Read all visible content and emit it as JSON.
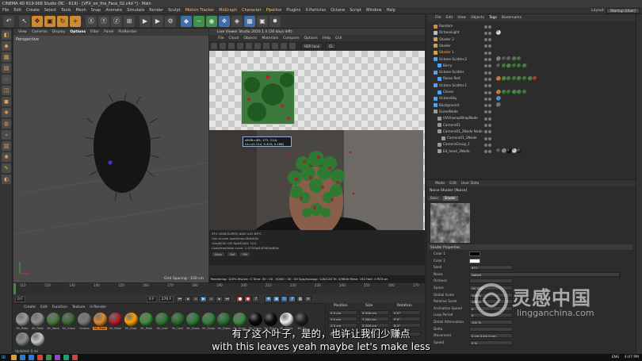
{
  "window": {
    "title": "CINEMA 4D R19.068 Studio (RC - R19) - [VFX_on_the_Face_02.c4d *] - Main",
    "layout_label": "Layout:",
    "layout_value": "Startup (User)"
  },
  "menubar": [
    "File",
    "Edit",
    "Create",
    "Select",
    "Tools",
    "Mesh",
    "Snap",
    "Animate",
    "Simulate",
    "Render",
    "Sculpt",
    "Motion Tracker",
    "MoGraph",
    "Character",
    "Pipeline",
    "Plugins",
    "X-Particles",
    "Octane",
    "Script",
    "Window",
    "Help"
  ],
  "viewport": {
    "menu": [
      "View",
      "Cameras",
      "Display",
      "Options",
      "Filter",
      "Panel",
      "ProRender"
    ],
    "label": "Perspective",
    "grid_spacing": "Grid Spacing : 100 cm"
  },
  "ipr": {
    "title": "Live Viewer Studio 2020.1.4 (26 days left)",
    "menu": [
      "File",
      "Cloud",
      "Objects",
      "Materials",
      "Compare",
      "Options",
      "Help",
      "GUI"
    ],
    "mode": "HDR tone",
    "channel": "DL",
    "pixel_info_1": "sRGB=(85, 173, 114)",
    "pixel_info_2": "Lin=(0.114, 0.419, 0.168)",
    "stats": [
      "RTX 2080(SUPER) 8GB     %25     89°C",
      "Out-of-core used/max:0Kb/4Gb",
      "GreyB/16: 0/0          Rgb32/64: 7/21",
      "Used/free/total vram: 1.473Gb/6.836Gb/8Gb"
    ],
    "stats_tabs": [
      "Main",
      "Ref",
      "Pth"
    ],
    "status": "Rendering: 100%  Ms/sec: 0  Time: 00 : 00 : 00/00 : 00 : 00  Spp/maxspp: 128/128  Tri: 0/964k  Mesh: 192  Hair: 0  RTX:on"
  },
  "timeline": {
    "ticks": [
      "110",
      "120",
      "130",
      "140",
      "150",
      "160",
      "170",
      "180",
      "190",
      "200",
      "210",
      "220",
      "230",
      "240",
      "250",
      "260",
      "270"
    ],
    "frame_start": "0 F",
    "frame_current": "0 F",
    "frame_end": "270 F",
    "frame_max": "270 F",
    "fps_label": "127 F"
  },
  "materials": {
    "menu": [
      "Create",
      "Edit",
      "Function",
      "Texture",
      "U-Render"
    ],
    "items": [
      {
        "name": "Mr_Petal",
        "color": "#9a9a9a",
        "selected": false
      },
      {
        "name": "Mr_Petal",
        "color": "#8f8f8f",
        "selected": false
      },
      {
        "name": "Mr_Stem",
        "color": "#4c7a3c",
        "selected": false
      },
      {
        "name": "Mr_Grass",
        "color": "#3f6a35",
        "selected": false
      },
      {
        "name": "Octane",
        "color": "#7a7a7a",
        "selected": false
      },
      {
        "name": "Mr_Petal",
        "color": "#e08830",
        "selected": true
      },
      {
        "name": "Mr_Petal",
        "color": "#b01e2a",
        "selected": false
      },
      {
        "name": "Mr_Drop",
        "color": "#ffa000",
        "selected": false
      },
      {
        "name": "Mr_Petal",
        "color": "#3e8f3e",
        "selected": false
      },
      {
        "name": "Mr_Leaf",
        "color": "#2e7a32",
        "selected": false
      },
      {
        "name": "Mr_Leaf",
        "color": "#2b6b2e",
        "selected": false
      },
      {
        "name": "Mr_Grass",
        "color": "#2f7d36",
        "selected": false
      },
      {
        "name": "Mr_Grass",
        "color": "#33843a",
        "selected": false
      },
      {
        "name": "Mr_Grass",
        "color": "#2a6f30",
        "selected": false
      },
      {
        "name": "Mr_Grass",
        "color": "#3b8a40",
        "selected": false
      },
      {
        "name": "Mr_Grass",
        "color": "#080808",
        "selected": false
      },
      {
        "name": "Mr_Grass",
        "color": "#0d0d0d",
        "selected": false
      },
      {
        "name": "Mr_Grass",
        "color": "#eeeeee",
        "selected": false
      },
      {
        "name": "Mr_Gr",
        "color": "#222222",
        "selected": false
      }
    ],
    "row2": [
      {
        "name": "",
        "color": "#8a8a8a"
      },
      {
        "name": "",
        "color": "#c4c4c4"
      }
    ]
  },
  "coords": {
    "headers": [
      "Position",
      "Size",
      "Rotation"
    ],
    "rows": [
      [
        "X  0 cm",
        "X  200 cm",
        "H  0°"
      ],
      [
        "Y  0 cm",
        "Y  200 cm",
        "P  0°"
      ],
      [
        "Z  0 cm",
        "Z  200 cm",
        "B  0°"
      ]
    ],
    "mode1": "Object (Rel)",
    "mode2": "Size",
    "apply": "Apply"
  },
  "objmgr": {
    "menu": [
      "File",
      "Edit",
      "View",
      "Objects",
      "Tags",
      "Bookmarks"
    ],
    "active_menu": "Tags",
    "rows": [
      {
        "name": "Random",
        "indent": 1,
        "color": "#e08830",
        "tags": []
      },
      {
        "name": "OctaneLight",
        "indent": 1,
        "color": "#bbbbbb",
        "tags": [
          "#ffffff"
        ]
      },
      {
        "name": "Shader 2",
        "indent": 1,
        "color": "#d8a040",
        "tags": []
      },
      {
        "name": "Shader",
        "indent": 1,
        "color": "#d8a040",
        "tags": []
      },
      {
        "name": "Shader 1",
        "indent": 1,
        "color": "#d8a040",
        "tags": [],
        "highlight": true
      },
      {
        "name": "Octane Scatter.2",
        "indent": 1,
        "color": "#4aa3ff",
        "tags": [
          "#888",
          "#444",
          "#555",
          "#3a7a3a",
          "#2e6b2e"
        ]
      },
      {
        "name": "Berry",
        "indent": 2,
        "color": "#4aa3ff",
        "tags": [
          "#444",
          "#2e6b2e",
          "#3e8f3e",
          "#2a5a2a",
          "#2e6b2e",
          "#3a7a3a"
        ]
      },
      {
        "name": "Octane Scatter",
        "indent": 1,
        "color": "#4aa3ff",
        "tags": []
      },
      {
        "name": "Roses Red",
        "indent": 2,
        "color": "#4aa3ff",
        "tags": [
          "#e08830",
          "#3e8f3e",
          "#2e7a32",
          "#2b6b2e",
          "#33843a",
          "#2a6f30",
          "#3b8a40",
          "#b01e2a"
        ]
      },
      {
        "name": "Octane Scatter.1",
        "indent": 1,
        "color": "#4aa3ff",
        "tags": []
      },
      {
        "name": "Clover",
        "indent": 2,
        "color": "#4aa3ff",
        "tags": [
          "#e08830",
          "#2e7a32",
          "#2b6b2e",
          "#3e8f3e",
          "#33843a",
          "#2a6f30"
        ]
      },
      {
        "name": "OctaneSky",
        "indent": 1,
        "color": "#4aa3ff",
        "tags": [
          "#4aa3ff"
        ]
      },
      {
        "name": "Background",
        "indent": 1,
        "color": "#4aa3ff",
        "tags": [
          "#777"
        ]
      },
      {
        "name": "SceneNode",
        "indent": 1,
        "color": "#999",
        "tags": []
      },
      {
        "name": "UVUnwrapWrapNode",
        "indent": 2,
        "color": "#999",
        "tags": []
      },
      {
        "name": "Camera01",
        "indent": 2,
        "color": "#999",
        "tags": []
      },
      {
        "name": "Camera01_2Node Node",
        "indent": 2,
        "color": "#999",
        "tags": []
      },
      {
        "name": "Camera01_2Node",
        "indent": 3,
        "color": "#999",
        "tags": []
      },
      {
        "name": "CameraGroup_1",
        "indent": 2,
        "color": "#999",
        "tags": []
      },
      {
        "name": "Ed_head_3Node",
        "indent": 2,
        "color": "#999",
        "tags": [
          "#444",
          "#9a9a9a",
          "#080808",
          "#eeeeee",
          "#222"
        ]
      }
    ]
  },
  "attrmgr": {
    "menu": [
      "Mode",
      "Edit",
      "User Data"
    ],
    "shader_title": "Noise Shader [Noise]",
    "tabs": [
      "Basic",
      "Shader"
    ],
    "active_tab": "Shader",
    "section": "Shader Properties",
    "props": [
      {
        "label": "Color 1",
        "type": "swatch",
        "value": "#000000"
      },
      {
        "label": "Color 2",
        "type": "swatch",
        "value": "#ffffff"
      },
      {
        "label": "Seed",
        "type": "field",
        "value": "671"
      },
      {
        "label": "Noise",
        "type": "field",
        "value": "Naked"
      },
      {
        "label": "Octaves",
        "type": "field",
        "value": ""
      },
      {
        "label": "Space",
        "type": "field",
        "value": "UV (2D)"
      },
      {
        "label": "Global Scale",
        "type": "field",
        "value": "100 %"
      },
      {
        "label": "Relative Scale",
        "type": "field",
        "value": "100 %"
      },
      {
        "label": "Animation Speed",
        "type": "field",
        "value": "0"
      },
      {
        "label": "Loop Period",
        "type": "field",
        "value": "0"
      },
      {
        "label": "Detail Attenuation",
        "type": "field",
        "value": "100 %"
      },
      {
        "label": "Delta",
        "type": "field",
        "value": ""
      },
      {
        "label": "Movement",
        "type": "field",
        "value": "0 cm   0 cm   0 cm"
      },
      {
        "label": "Speed",
        "type": "field",
        "value": "0 %"
      }
    ]
  },
  "taskbar": {
    "lang": "ENG",
    "time": "4:07 PM",
    "icon_colors": [
      "#d6a030",
      "#2d7bd6",
      "#2d7bd6",
      "#e0412f",
      "#3f8f4d",
      "#9a3fd6",
      "#1f9f6f",
      "#d64040"
    ]
  },
  "subtitle": {
    "cn": "有了这个叶子，是的，也许让我们少赚点",
    "en": "with this leaves yeah maybe let's make less"
  },
  "watermark": {
    "cn": "灵感中国",
    "url": "lingganchina.com"
  },
  "status_bar": "Updated: 0 ms"
}
